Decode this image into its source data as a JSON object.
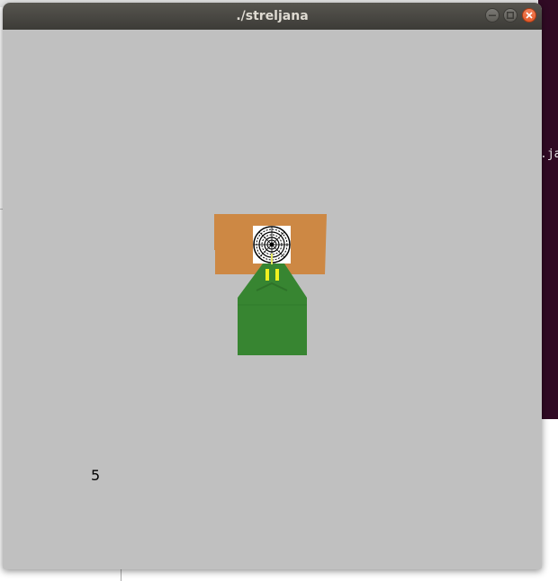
{
  "window": {
    "title": "./streljana",
    "buttons": {
      "minimize": "minimize-icon",
      "maximize": "maximize-icon",
      "close": "close-icon"
    }
  },
  "background": {
    "terminal_fragment": ".ja"
  },
  "game": {
    "score": "5",
    "colors": {
      "background": "#c0c0c0",
      "target_board": "#cd8844",
      "target_face": "#ffffff",
      "gun_body": "#378531",
      "barrel": "#f0f020"
    }
  }
}
